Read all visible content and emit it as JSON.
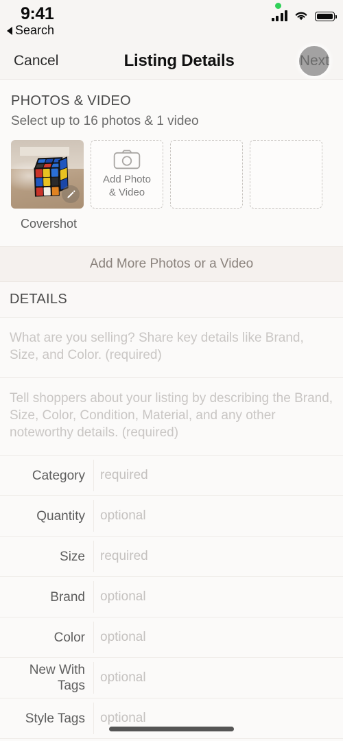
{
  "status_bar": {
    "time": "9:41",
    "back_label": "Search",
    "icons": [
      "recording-dot",
      "cellular-icon",
      "wifi-icon",
      "battery-icon"
    ]
  },
  "nav_bar": {
    "cancel_label": "Cancel",
    "title": "Listing Details",
    "next_label": "Next",
    "tap_indicator": true
  },
  "photos_section": {
    "header": "PHOTOS & VIDEO",
    "subtitle": "Select up to 16 photos & 1 video",
    "add_slot_label_line1": "Add Photo",
    "add_slot_label_line2": "& Video",
    "covershot_label": "Covershot",
    "thumbnail_alt": "Rubik's cube on wooden table",
    "edit_badge_icon": "pencil-icon",
    "empty_slot_count": 2
  },
  "add_more": {
    "label": "Add More Photos or a Video"
  },
  "details_section": {
    "header": "DETAILS",
    "title_placeholder": "What are you selling? Share key details like Brand, Size, and Color. (required)",
    "description_placeholder": "Tell shoppers about your listing by describing the Brand, Size, Color, Condition, Material, and any other noteworthy details. (required)",
    "rows": [
      {
        "label": "Category",
        "value": "required"
      },
      {
        "label": "Quantity",
        "value": "optional"
      },
      {
        "label": "Size",
        "value": "required"
      },
      {
        "label": "Brand",
        "value": "optional"
      },
      {
        "label": "Color",
        "value": "optional"
      },
      {
        "label": "New With Tags",
        "value": "optional"
      },
      {
        "label": "Style Tags",
        "value": "optional"
      }
    ]
  },
  "colors": {
    "page_background": "#fbfaf9",
    "bar_background": "#f7f5f3",
    "band_background": "#f5f1ee",
    "label_text": "#5d5d5d",
    "placeholder_text": "#c4c1bf",
    "recording_dot": "#30d158"
  }
}
